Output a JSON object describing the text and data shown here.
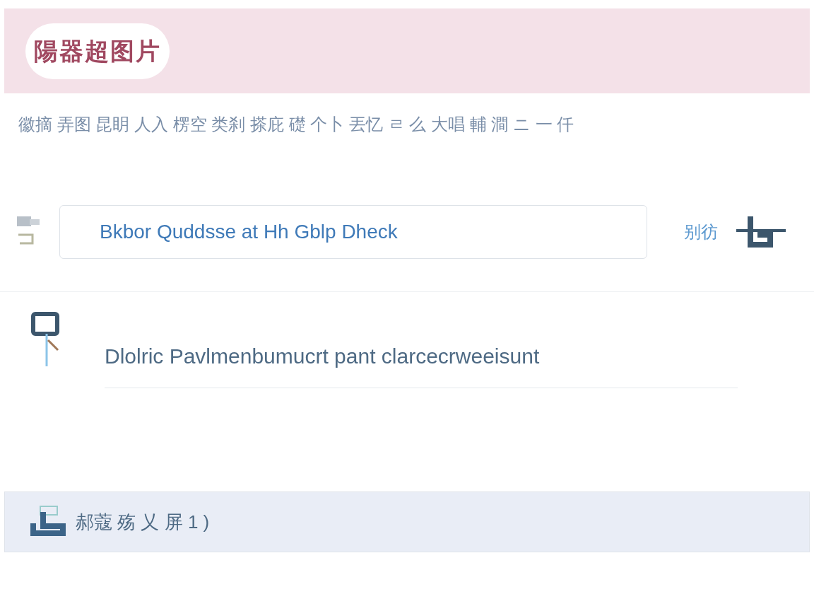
{
  "header": {
    "logo": "陽器超图片"
  },
  "description": "徽摘 弄图 昆眀 人入 楞空 类刹 搽庇 礎 个卜 丟忆 ㄹ 么 大唱 輔 澗 ニ 一 仟",
  "search": {
    "value": "Bkbor Quddsse at Hh Gblp Dheck",
    "side_label": "别彷"
  },
  "item": {
    "text": "Dlolric Pavlmenbumucrt pant  clarcecrweeisunt"
  },
  "footer": {
    "text": "郝蔻 殇 乂 屏 1 )"
  }
}
